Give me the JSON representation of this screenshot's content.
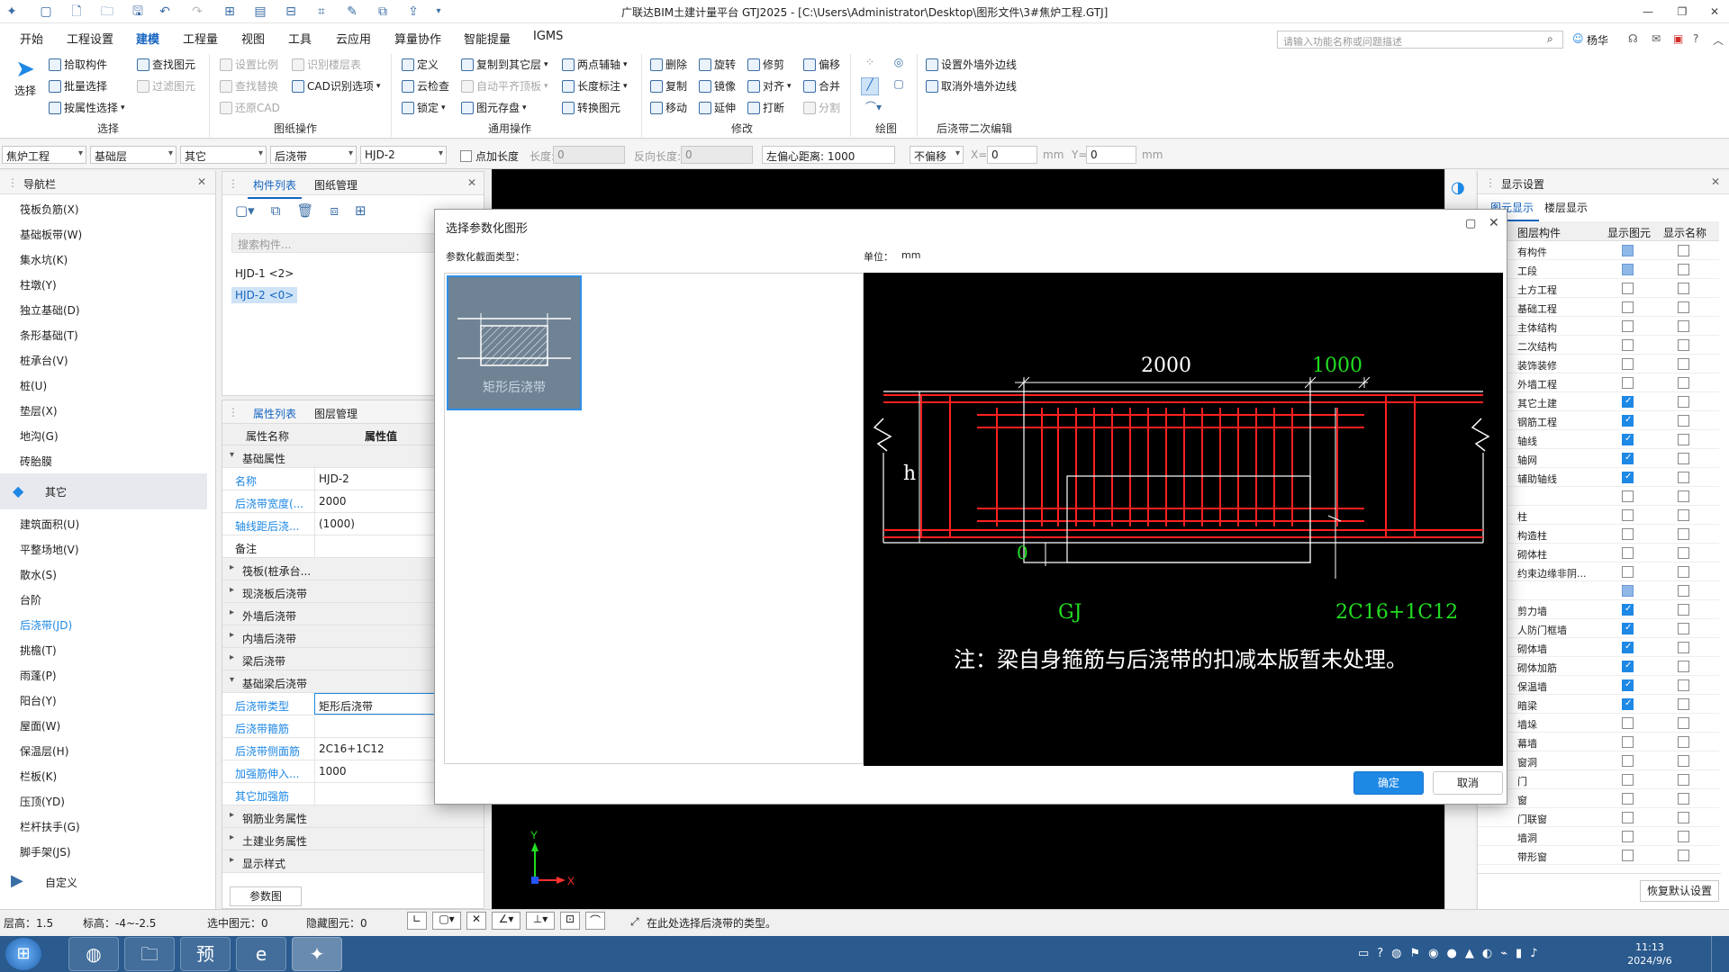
{
  "window": {
    "title": "广联达BIM土建计量平台 GTJ2025 - [C:\\Users\\Administrator\\Desktop\\图形文件\\3#焦炉工程.GTJ]"
  },
  "menu": {
    "items": [
      "开始",
      "工程设置",
      "建模",
      "工程量",
      "视图",
      "工具",
      "云应用",
      "算量协作",
      "智能提量",
      "IGMS"
    ],
    "active": "建模",
    "search_placeholder": "请输入功能名称或问题描述",
    "user": "杨华"
  },
  "ribbon": {
    "select_big": "选择",
    "select": [
      "拾取构件",
      "批量选择",
      "按属性选择"
    ],
    "find": [
      "查找图元",
      "过滤图元"
    ],
    "drawing_ops": [
      "设置比例",
      "识别楼层表",
      "查找替换",
      "CAD识别选项",
      "还原CAD"
    ],
    "general": [
      "定义",
      "复制到其它层",
      "两点辅轴",
      "云检查",
      "自动平齐顶板",
      "长度标注",
      "锁定",
      "图元存盘",
      "转换图元"
    ],
    "modify": [
      "删除",
      "旋转",
      "修剪",
      "偏移",
      "复制",
      "镜像",
      "对齐",
      "合并",
      "移动",
      "延伸",
      "打断",
      "分割"
    ],
    "wall_edge": [
      "设置外墙外边线",
      "取消外墙外边线"
    ],
    "groups": [
      "选择",
      "图纸操作",
      "通用操作",
      "修改",
      "绘图",
      "后浇带二次编辑"
    ]
  },
  "toolbar2": {
    "project": "焦炉工程",
    "floor": "基础层",
    "category": "其它",
    "type": "后浇带",
    "component": "HJD-2",
    "point_len_label": "点加长度",
    "len_label": "长度:",
    "len_value": "0",
    "rev_len_label": "反向长度:",
    "rev_len_value": "0",
    "offset_label": "左偏心距离: 1000",
    "offset_mode": "不偏移",
    "x_label": "X=",
    "x_value": "0",
    "y_label": "Y=",
    "y_value": "0",
    "unit": "mm"
  },
  "nav": {
    "title": "导航栏",
    "items_top": [
      "筏板负筋(X)",
      "基础板带(W)",
      "集水坑(K)",
      "柱墩(Y)",
      "独立基础(D)",
      "条形基础(T)",
      "桩承台(V)",
      "桩(U)",
      "垫层(X)",
      "地沟(G)",
      "砖胎膜"
    ],
    "group": "其它",
    "items_other": [
      "建筑面积(U)",
      "平整场地(V)",
      "散水(S)",
      "台阶",
      "后浇带(JD)",
      "挑檐(T)",
      "雨蓬(P)",
      "阳台(Y)",
      "屋面(W)",
      "保温层(H)",
      "栏板(K)",
      "压顶(YD)",
      "栏杆扶手(G)",
      "脚手架(JS)"
    ],
    "selected": "后浇带(JD)",
    "custom": "自定义"
  },
  "components": {
    "tabs": [
      "构件列表",
      "图纸管理"
    ],
    "search_placeholder": "搜索构件...",
    "items": [
      "HJD-1 <2>",
      "HJD-2 <0>"
    ]
  },
  "attributes": {
    "tabs": [
      "属性列表",
      "图层管理"
    ],
    "header": [
      "属性名称",
      "属性值"
    ],
    "group_basic": "基础属性",
    "rows_basic": [
      {
        "k": "名称",
        "v": "HJD-2"
      },
      {
        "k": "后浇带宽度(...",
        "v": "2000"
      },
      {
        "k": "轴线距后浇...",
        "v": "(1000)"
      },
      {
        "k": "备注",
        "v": ""
      }
    ],
    "groups_mid": [
      "筏板(桩承台...",
      "现浇板后浇带",
      "外墙后浇带",
      "内墙后浇带",
      "梁后浇带"
    ],
    "group_found_beam": "基础梁后浇带",
    "rows_beam": [
      {
        "k": "后浇带类型",
        "v": "矩形后浇带"
      },
      {
        "k": "后浇带箍筋",
        "v": ""
      },
      {
        "k": "后浇带侧面筋",
        "v": "2C16+1C12"
      },
      {
        "k": "加强筋伸入...",
        "v": "1000"
      },
      {
        "k": "其它加强筋",
        "v": ""
      }
    ],
    "groups_bottom": [
      "钢筋业务属性",
      "土建业务属性",
      "显示样式"
    ],
    "param_btn": "参数图"
  },
  "display": {
    "title": "显示设置",
    "tabs": [
      "图元显示",
      "楼层显示"
    ],
    "columns": [
      "图层构件",
      "显示图元",
      "显示名称"
    ],
    "rows": [
      {
        "n": "有构件",
        "a": "partial",
        "b": "off"
      },
      {
        "n": "工段",
        "a": "partial",
        "b": "off"
      },
      {
        "n": "土方工程",
        "a": "off",
        "b": "off"
      },
      {
        "n": "基础工程",
        "a": "off",
        "b": "off"
      },
      {
        "n": "主体结构",
        "a": "off",
        "b": "off"
      },
      {
        "n": "二次结构",
        "a": "off",
        "b": "off"
      },
      {
        "n": "装饰装修",
        "a": "off",
        "b": "off"
      },
      {
        "n": "外墙工程",
        "a": "off",
        "b": "off"
      },
      {
        "n": "其它土建",
        "a": "on",
        "b": "off"
      },
      {
        "n": "钢筋工程",
        "a": "on",
        "b": "off"
      },
      {
        "n": "轴线",
        "a": "on",
        "b": "off"
      },
      {
        "n": "轴网",
        "a": "on",
        "b": "off"
      },
      {
        "n": "辅助轴线",
        "a": "on",
        "b": "off"
      },
      {
        "n": "",
        "a": "off",
        "b": "off"
      },
      {
        "n": "柱",
        "a": "off",
        "b": "off"
      },
      {
        "n": "构造柱",
        "a": "off",
        "b": "off"
      },
      {
        "n": "砌体柱",
        "a": "off",
        "b": "off"
      },
      {
        "n": "约束边缘非阴...",
        "a": "off",
        "b": "off"
      },
      {
        "n": "",
        "a": "partial",
        "b": "off"
      },
      {
        "n": "剪力墙",
        "a": "on",
        "b": "off"
      },
      {
        "n": "人防门框墙",
        "a": "on",
        "b": "off"
      },
      {
        "n": "砌体墙",
        "a": "on",
        "b": "off"
      },
      {
        "n": "砌体加筋",
        "a": "on",
        "b": "off"
      },
      {
        "n": "保温墙",
        "a": "on",
        "b": "off"
      },
      {
        "n": "暗梁",
        "a": "on",
        "b": "off"
      },
      {
        "n": "墙垛",
        "a": "off",
        "b": "off"
      },
      {
        "n": "幕墙",
        "a": "off",
        "b": "off"
      },
      {
        "n": "窗洞",
        "a": "off",
        "b": "off"
      },
      {
        "n": "门",
        "a": "off",
        "b": "off"
      },
      {
        "n": "窗",
        "a": "off",
        "b": "off"
      },
      {
        "n": "门联窗",
        "a": "off",
        "b": "off"
      },
      {
        "n": "墙洞",
        "a": "off",
        "b": "off"
      },
      {
        "n": "带形窗",
        "a": "off",
        "b": "off"
      }
    ],
    "reset_btn": "恢复默认设置"
  },
  "dialog": {
    "title": "选择参数化图形",
    "section_label": "参数化截面类型：",
    "unit_label": "单位：",
    "unit_value": "mm",
    "shape_name": "矩形后浇带",
    "dim_main": "2000",
    "dim_extend": "1000",
    "dim_h": "h",
    "dim_zero": "0",
    "label_gj": "GJ",
    "label_rebar": "2C16+1C12",
    "note": "注：梁自身箍筋与后浇带的扣减本版暂未处理。",
    "ok": "确定",
    "cancel": "取消"
  },
  "status": {
    "floor_h": "层高：1.5",
    "elev": "标高：-4~-2.5",
    "selected": "选中图元：0",
    "hidden": "隐藏图元：0",
    "hint": "在此处选择后浇带的类型。"
  },
  "taskbar": {
    "time": "11:13",
    "date": "2024/9/6"
  },
  "colors": {
    "accent": "#1e88e5",
    "rebar_red": "#ff2020",
    "dim_green": "#22dd22"
  }
}
